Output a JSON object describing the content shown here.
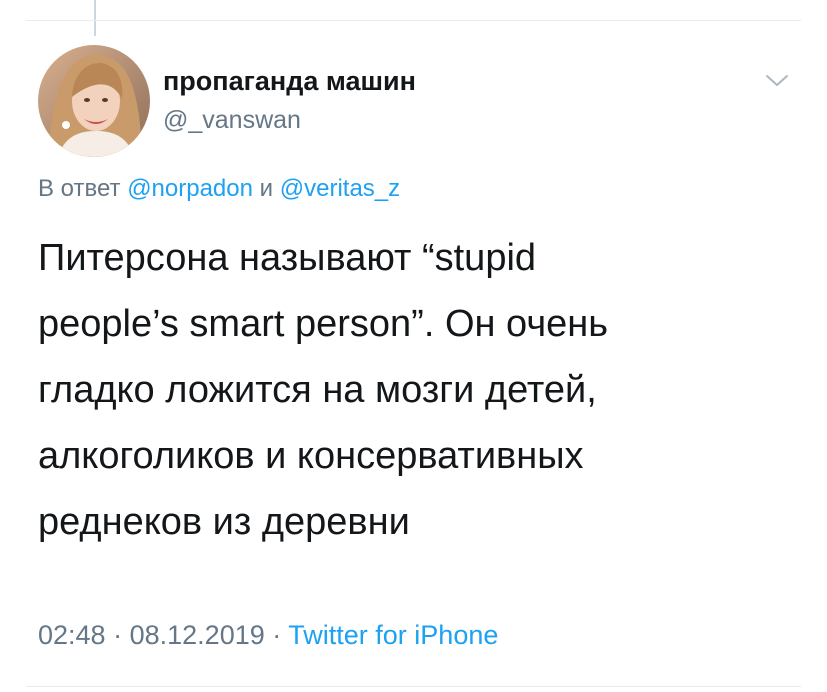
{
  "tweet": {
    "author": {
      "display_name": "пропаганда машин",
      "handle": "@_vanswan"
    },
    "reply": {
      "prefix": "В ответ",
      "mention_1": "@norpadon",
      "conjunction": "и",
      "mention_2": "@veritas_z"
    },
    "text_lines": [
      "Питерсона называют “stupid",
      "people’s smart person”. Он очень",
      "гладко ложится на мозги детей,",
      "алкоголиков и консервативных",
      "реднеков из деревни"
    ],
    "time": "02:48",
    "separator": "·",
    "date": "08.12.2019",
    "source": "Twitter for iPhone"
  },
  "colors": {
    "link": "#1da1f2",
    "secondary": "#657786",
    "text": "#14171a",
    "divider": "#e6ecf0"
  },
  "icons": {
    "menu": "chevron-down-icon",
    "avatar": "avatar-photo"
  }
}
